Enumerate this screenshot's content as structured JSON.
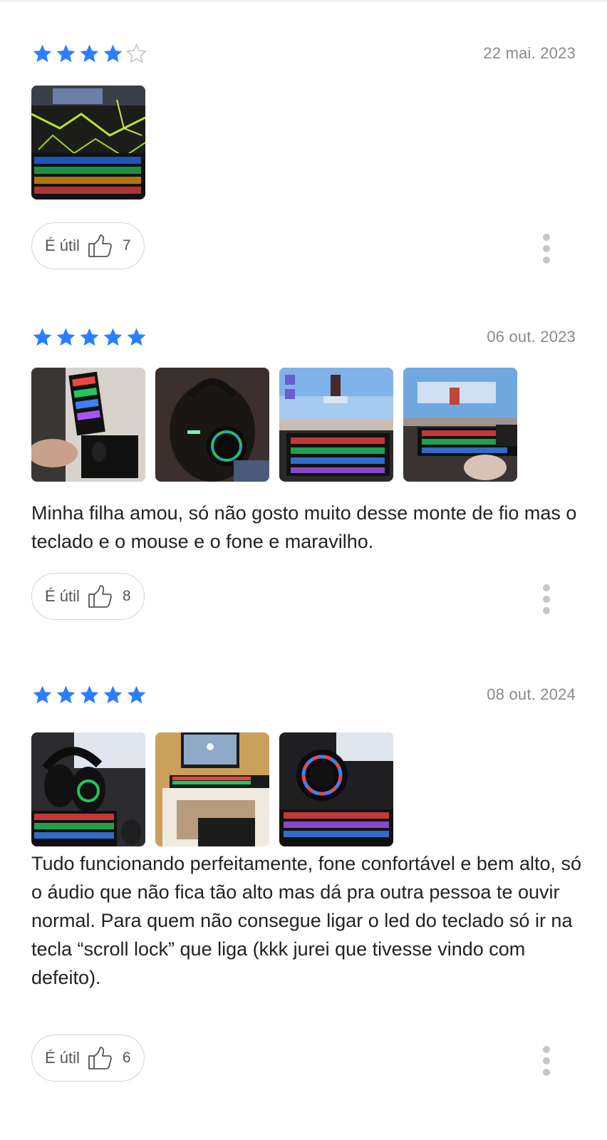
{
  "colors": {
    "star_filled": "#2b7fff",
    "star_empty": "#c7c7c7",
    "date": "#8a8a8a"
  },
  "reviews": [
    {
      "rating": 4,
      "date": "22 mai. 2023",
      "photos": [
        "keyboard-rgb-cracked-wallpaper"
      ],
      "text": "",
      "helpful_label": "É útil",
      "helpful_count": "7"
    },
    {
      "rating": 5,
      "date": "06 out. 2023",
      "photos": [
        "keyboard-mouse-desk",
        "headset-on-child",
        "monitor-game-keyboard",
        "keyboard-monitor-game"
      ],
      "text": "Minha filha amou, só não gosto muito desse monte de fio mas o teclado e o mouse e o fone e maravilho.",
      "helpful_label": "É útil",
      "helpful_count": "8"
    },
    {
      "rating": 5,
      "date": "08 out. 2024",
      "photos": [
        "headset-keyboard",
        "desk-monitor-keyboard",
        "headset-ring-led"
      ],
      "text": "Tudo funcionando perfeitamente, fone confortável e bem alto, só o áudio que não fica tão alto mas dá pra outra pessoa te ouvir normal. Para quem não consegue ligar o led do teclado só ir na tecla “scroll lock” que liga (kkk jurei que tivesse vindo com defeito).",
      "helpful_label": "É útil",
      "helpful_count": "6"
    }
  ]
}
